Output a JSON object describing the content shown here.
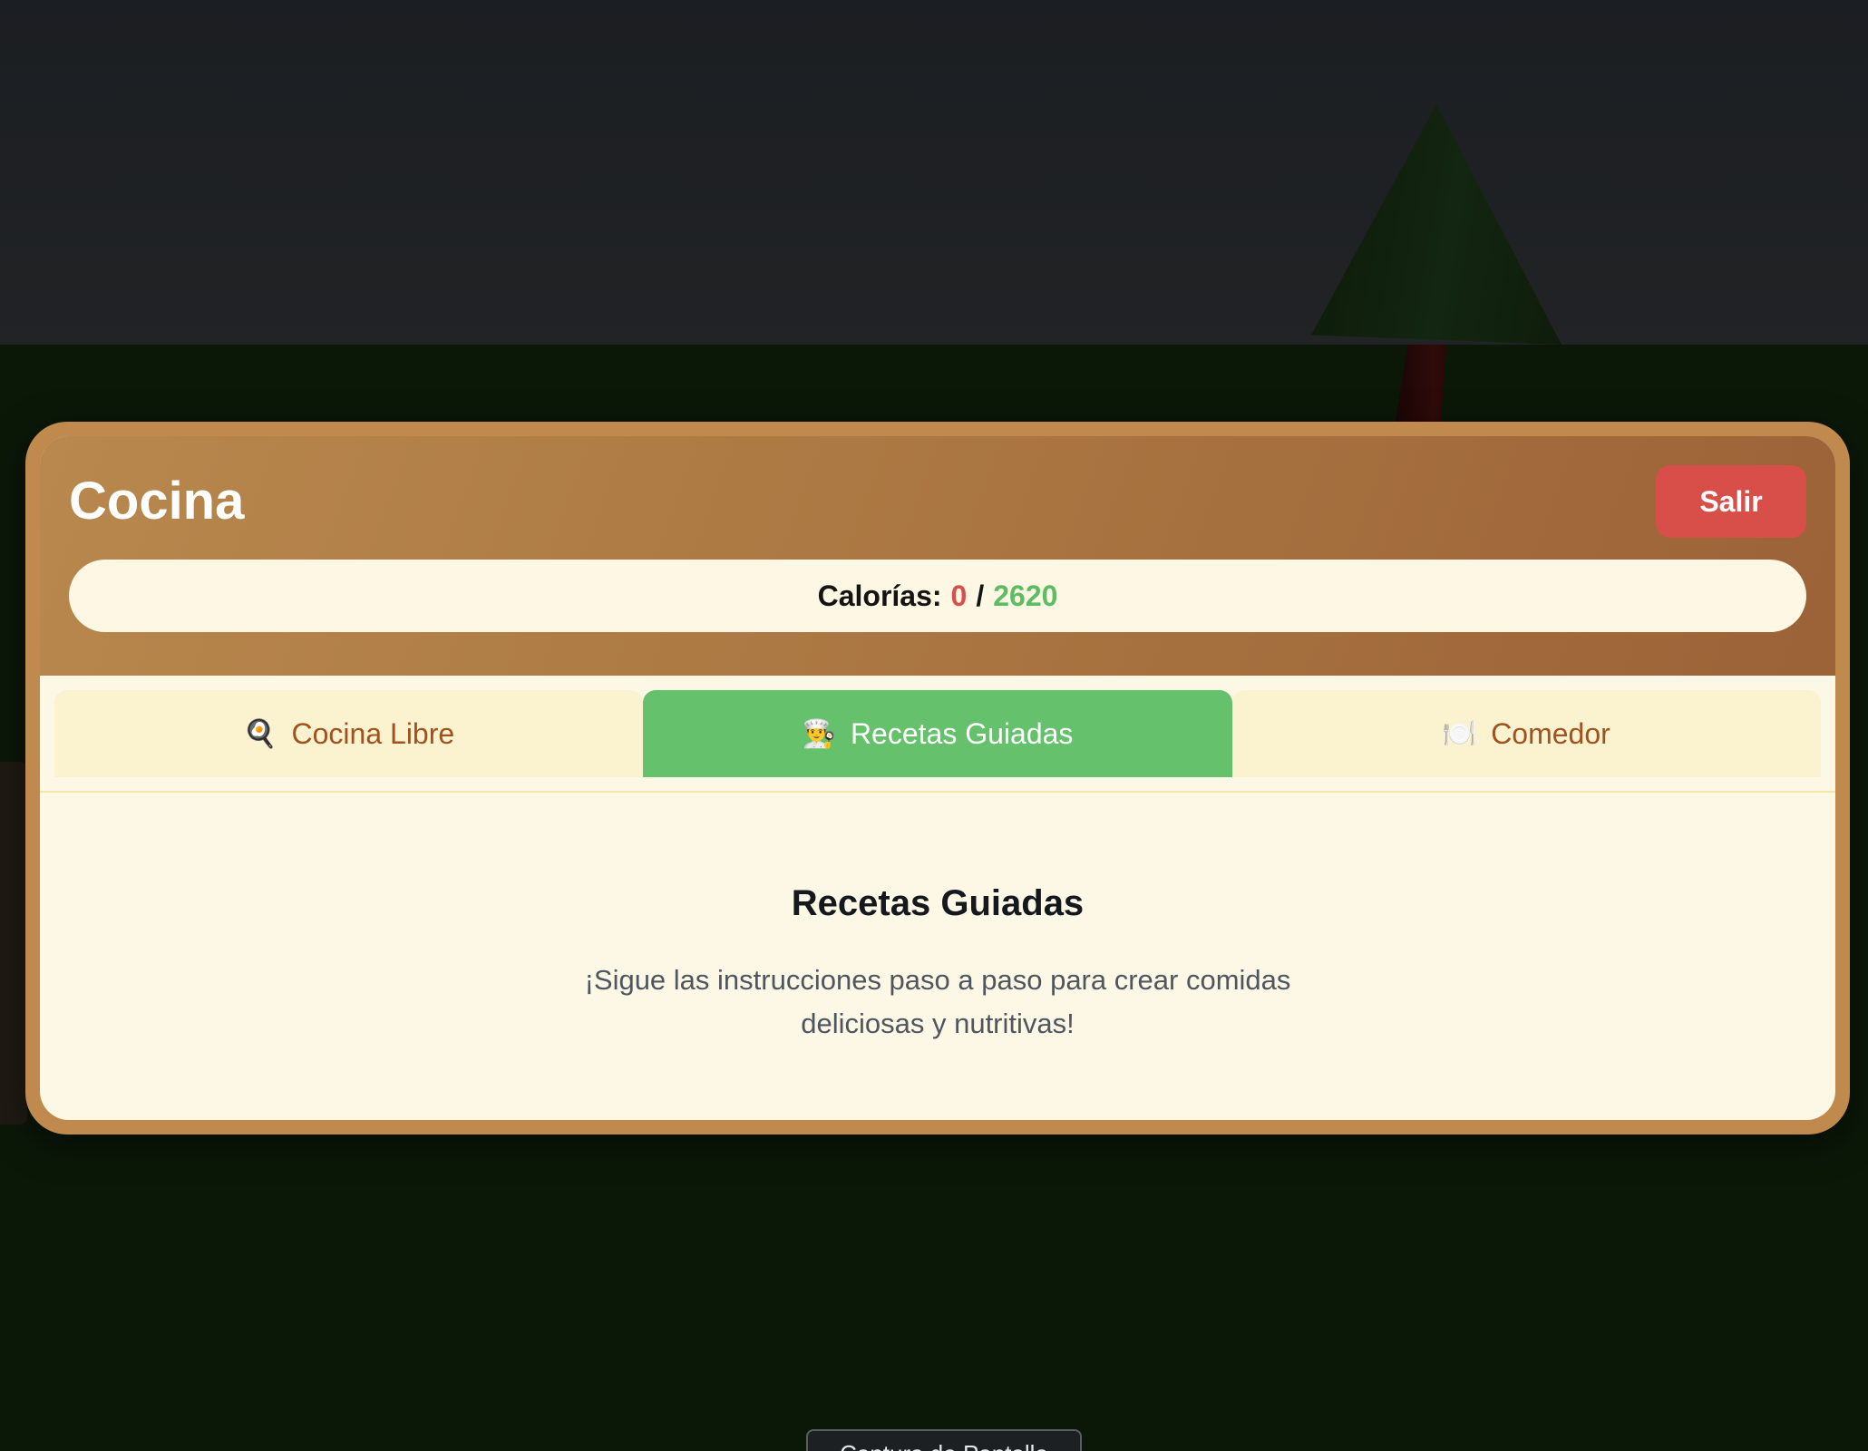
{
  "kitchen": {
    "title": "Cocina",
    "exit_label": "Salir",
    "calories": {
      "label": "Calorías:",
      "current": "0",
      "separator": "/",
      "target": "2620"
    }
  },
  "tabs": [
    {
      "icon": "🍳",
      "icon_name": "frying-pan-icon",
      "label": "Cocina Libre",
      "active": false
    },
    {
      "icon": "👨‍🍳",
      "icon_name": "chef-icon",
      "label": "Recetas Guiadas",
      "active": true
    },
    {
      "icon": "🍽️",
      "icon_name": "plate-icon",
      "label": "Comedor",
      "active": false
    }
  ],
  "content": {
    "heading": "Recetas Guiadas",
    "description": "¡Sigue las instrucciones paso a paso para crear comidas deliciosas y nutritivas!"
  },
  "screenshot_button": {
    "label": "Captura de Pantalla"
  },
  "colors": {
    "frame": "#c0894d",
    "exit": "#d84f4a",
    "active_tab": "#66c16c",
    "calories_current": "#d84f4a",
    "calories_target": "#5dbc64"
  }
}
